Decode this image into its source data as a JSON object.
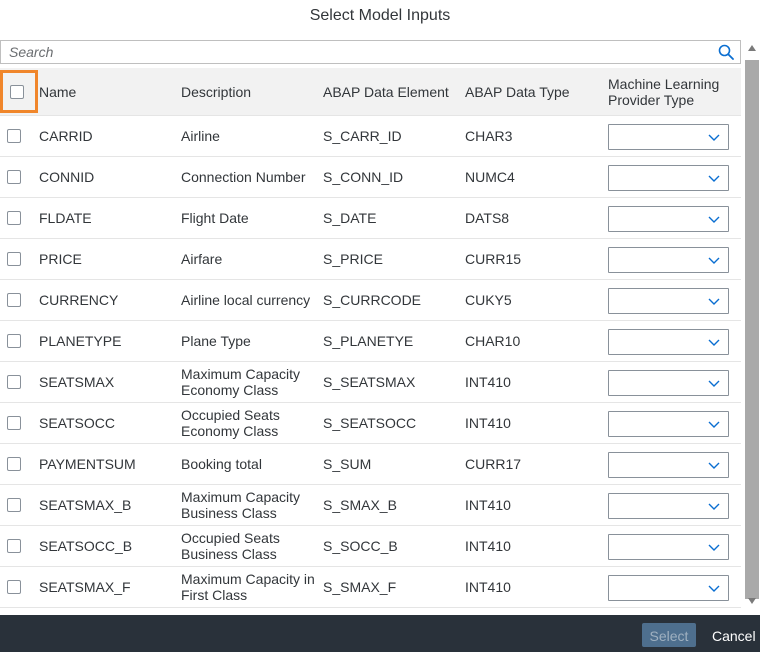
{
  "dialog": {
    "title": "Select Model Inputs"
  },
  "search": {
    "placeholder": "Search",
    "value": ""
  },
  "table": {
    "columns": [
      "Name",
      "Description",
      "ABAP Data Element",
      "ABAP Data Type",
      "Machine Learning Provider Type"
    ],
    "rows": [
      {
        "name": "CARRID",
        "description": "Airline",
        "data_element": "S_CARR_ID",
        "data_type": "CHAR3",
        "ml_type": ""
      },
      {
        "name": "CONNID",
        "description": "Connection Number",
        "data_element": "S_CONN_ID",
        "data_type": "NUMC4",
        "ml_type": ""
      },
      {
        "name": "FLDATE",
        "description": "Flight Date",
        "data_element": "S_DATE",
        "data_type": "DATS8",
        "ml_type": ""
      },
      {
        "name": "PRICE",
        "description": "Airfare",
        "data_element": "S_PRICE",
        "data_type": "CURR15",
        "ml_type": ""
      },
      {
        "name": "CURRENCY",
        "description": "Airline local currency",
        "data_element": "S_CURRCODE",
        "data_type": "CUKY5",
        "ml_type": ""
      },
      {
        "name": "PLANETYPE",
        "description": "Plane Type",
        "data_element": "S_PLANETYE",
        "data_type": "CHAR10",
        "ml_type": ""
      },
      {
        "name": "SEATSMAX",
        "description": "Maximum Capacity Economy Class",
        "data_element": "S_SEATSMAX",
        "data_type": "INT410",
        "ml_type": ""
      },
      {
        "name": "SEATSOCC",
        "description": "Occupied Seats Economy Class",
        "data_element": "S_SEATSOCC",
        "data_type": "INT410",
        "ml_type": ""
      },
      {
        "name": "PAYMENTSUM",
        "description": "Booking total",
        "data_element": "S_SUM",
        "data_type": "CURR17",
        "ml_type": ""
      },
      {
        "name": "SEATSMAX_B",
        "description": "Maximum Capacity Business Class",
        "data_element": "S_SMAX_B",
        "data_type": "INT410",
        "ml_type": ""
      },
      {
        "name": "SEATSOCC_B",
        "description": "Occupied Seats Business Class",
        "data_element": "S_SOCC_B",
        "data_type": "INT410",
        "ml_type": ""
      },
      {
        "name": "SEATSMAX_F",
        "description": "Maximum Capacity in First Class",
        "data_element": "S_SMAX_F",
        "data_type": "INT410",
        "ml_type": ""
      }
    ]
  },
  "footer": {
    "select_label": "Select",
    "cancel_label": "Cancel"
  },
  "icons": {
    "search": "search-icon",
    "dropdown": "chevron-down-icon",
    "scroll_up": "scroll-up-icon",
    "scroll_down": "scroll-down-icon"
  },
  "colors": {
    "highlight": "#f0862b",
    "footer_bg": "#29313a",
    "select_button_bg": "#4e6f8e",
    "header_bg": "#f2f2f2"
  }
}
